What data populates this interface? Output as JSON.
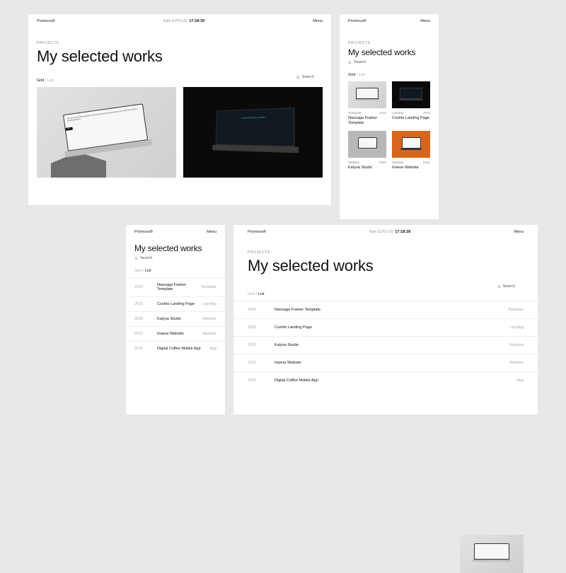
{
  "brand": "Promova®",
  "menu": "Menu",
  "tz": "Kyiv (UTC+3)",
  "time_a": "17:18:30",
  "time_b": "17:18:28",
  "section": "PROJECTS",
  "heading": "My selected works",
  "search": "Search",
  "view": {
    "grid": "Grid",
    "list": "List",
    "sep": "/"
  },
  "cards": [
    {
      "cat": "Template",
      "year": "2024",
      "name": "Nasnaga Framer Template"
    },
    {
      "cat": "Landing",
      "year": "2023",
      "name": "Coshto Landing Page"
    },
    {
      "cat": "Website",
      "year": "2023",
      "name": "Kalyna Studio"
    },
    {
      "cat": "Website",
      "year": "2022",
      "name": "Inwear Website"
    }
  ],
  "list": [
    {
      "year": "2024",
      "name": "Nasnaga Framer Template",
      "cat": "Template"
    },
    {
      "year": "2023",
      "name": "Coshto Landing Page",
      "cat": "Landing"
    },
    {
      "year": "2023",
      "name": "Kalyna Studio",
      "cat": "Website"
    },
    {
      "year": "2022",
      "name": "Inwear Website",
      "cat": "Website"
    },
    {
      "year": "2022",
      "name": "Digital Coffee Mobile App",
      "cat": "App"
    }
  ],
  "mock": {
    "light_text": "We research & build strategy & and create people-oriented design & for small and medium-sized businesses.",
    "dark_text": "Grow the brand and your match"
  }
}
